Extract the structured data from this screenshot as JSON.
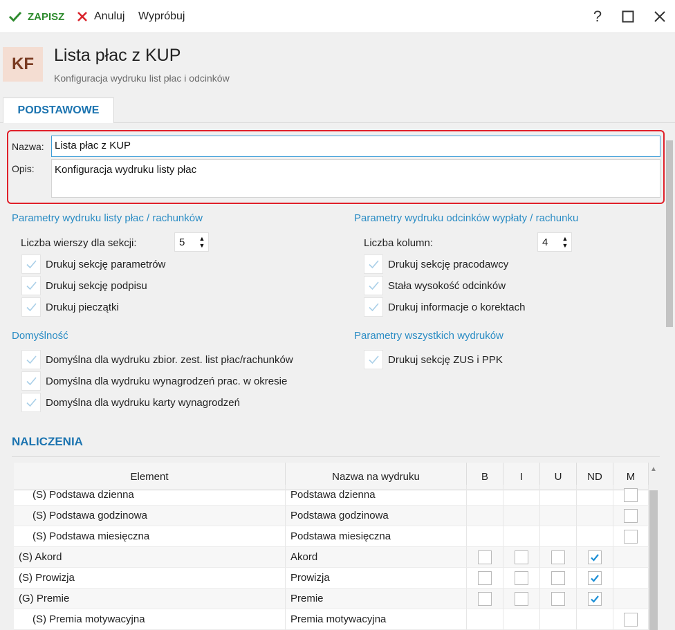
{
  "toolbar": {
    "save_label": "ZAPISZ",
    "cancel_label": "Anuluj",
    "try_label": "Wypróbuj",
    "colors": {
      "save": "#2e8b2e",
      "cancel": "#d9232b"
    }
  },
  "window_controls": {
    "help": "?",
    "close": "✕"
  },
  "header": {
    "badge": "KF",
    "title": "Lista płac z KUP",
    "subtitle": "Konfiguracja wydruku list płac i odcinków"
  },
  "tabs": [
    {
      "label": "PODSTAWOWE",
      "active": true
    }
  ],
  "form": {
    "name_label": "Nazwa:",
    "name_value": "Lista płac z KUP",
    "desc_label": "Opis:",
    "desc_value": "Konfiguracja wydruku listy płac"
  },
  "params_list": {
    "title": "Parametry wydruku listy płac / rachunków",
    "rows_label": "Liczba wierszy dla sekcji:",
    "rows_value": "5",
    "options": [
      {
        "label": "Drukuj sekcję parametrów",
        "checked": true
      },
      {
        "label": "Drukuj sekcję podpisu",
        "checked": true
      },
      {
        "label": "Drukuj pieczątki",
        "checked": true
      }
    ]
  },
  "params_slips": {
    "title": "Parametry wydruku odcinków wypłaty / rachunku",
    "cols_label": "Liczba kolumn:",
    "cols_value": "4",
    "options": [
      {
        "label": "Drukuj sekcję pracodawcy",
        "checked": true
      },
      {
        "label": "Stała wysokość odcinków",
        "checked": true
      },
      {
        "label": "Drukuj informacje o korektach",
        "checked": true
      }
    ]
  },
  "defaults": {
    "title": "Domyślność",
    "options": [
      {
        "label": "Domyślna dla wydruku zbior. zest. list płac/rachunków",
        "checked": true
      },
      {
        "label": "Domyślna dla wydruku wynagrodzeń prac. w okresie",
        "checked": true
      },
      {
        "label": "Domyślna dla wydruku karty wynagrodzeń",
        "checked": true
      }
    ]
  },
  "params_all": {
    "title": "Parametry wszystkich wydruków",
    "options": [
      {
        "label": "Drukuj sekcję ZUS i PPK",
        "checked": true
      }
    ]
  },
  "naliczenia": {
    "title": "NALICZENIA",
    "columns": [
      "Element",
      "Nazwa na wydruku",
      "B",
      "I",
      "U",
      "ND",
      "M"
    ],
    "rows": [
      {
        "element": "(S) Podstawa dzienna",
        "name": "Podstawa dzienna",
        "indent": true,
        "flags": null,
        "m": false
      },
      {
        "element": "(S) Podstawa godzinowa",
        "name": "Podstawa godzinowa",
        "indent": true,
        "flags": null,
        "m": false
      },
      {
        "element": "(S) Podstawa miesięczna",
        "name": "Podstawa miesięczna",
        "indent": true,
        "flags": null,
        "m": false
      },
      {
        "element": "(S) Akord",
        "name": "Akord",
        "indent": false,
        "flags": [
          false,
          false,
          false,
          true
        ],
        "m": null
      },
      {
        "element": "(S) Prowizja",
        "name": "Prowizja",
        "indent": false,
        "flags": [
          false,
          false,
          false,
          true
        ],
        "m": null
      },
      {
        "element": "(G) Premie",
        "name": "Premie",
        "indent": false,
        "flags": [
          false,
          false,
          false,
          true
        ],
        "m": null
      },
      {
        "element": "(S) Premia motywacyjna",
        "name": "Premia motywacyjna",
        "indent": true,
        "flags": null,
        "m": false
      }
    ]
  },
  "colors": {
    "accent": "#2a8cc4",
    "highlight_border": "#e0202a",
    "check": "#1c8fd6"
  }
}
